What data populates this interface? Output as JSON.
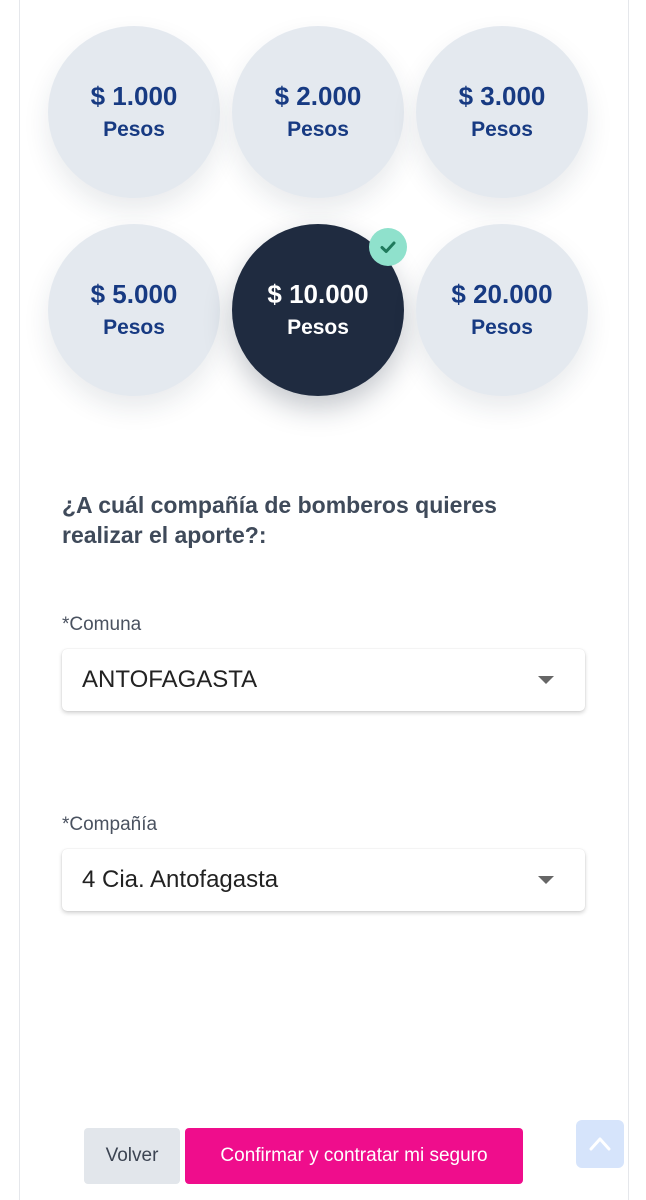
{
  "amount_options": [
    {
      "value": "$ 1.000",
      "unit": "Pesos",
      "selected": false
    },
    {
      "value": "$ 2.000",
      "unit": "Pesos",
      "selected": false
    },
    {
      "value": "$ 3.000",
      "unit": "Pesos",
      "selected": false
    },
    {
      "value": "$ 5.000",
      "unit": "Pesos",
      "selected": false
    },
    {
      "value": "$ 10.000",
      "unit": "Pesos",
      "selected": true
    },
    {
      "value": "$ 20.000",
      "unit": "Pesos",
      "selected": false
    }
  ],
  "question": "¿A cuál compañía de bomberos quieres realizar el aporte?:",
  "comuna": {
    "label": "*Comuna",
    "value": "ANTOFAGASTA"
  },
  "compania": {
    "label": "*Compañía",
    "value": "4 Cia. Antofagasta"
  },
  "actions": {
    "back_label": "Volver",
    "confirm_label": "Confirmar y contratar mi seguro"
  },
  "icons": {
    "selected_check": "check-icon",
    "select_caret": "chevron-down-icon",
    "back_to_top": "arrow-up-icon"
  },
  "colors": {
    "amount_bg": "#e4e9ef",
    "amount_text": "#173a82",
    "selected_bg": "#1f2b40",
    "check_badge": "#8fe1cc",
    "confirm_button": "#ef0d8c",
    "back_button": "#e2e6eb",
    "top_button": "#d6e4fb"
  }
}
